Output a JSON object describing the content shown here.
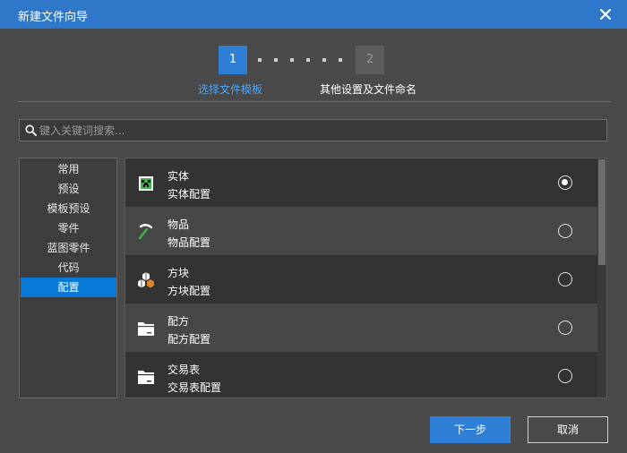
{
  "window": {
    "title": "新建文件向导"
  },
  "stepper": {
    "steps": [
      {
        "number": "1",
        "label": "选择文件模板",
        "active": true
      },
      {
        "number": "2",
        "label": "其他设置及文件命名",
        "active": false
      }
    ]
  },
  "search": {
    "placeholder": "键入关键词搜索...",
    "value": ""
  },
  "categories": {
    "items": [
      "常用",
      "预设",
      "模板预设",
      "零件",
      "蓝图零件",
      "代码",
      "配置"
    ],
    "selected_index": 6
  },
  "templates": [
    {
      "name": "实体",
      "description": "实体配置",
      "icon": "creeper-icon",
      "selected": true
    },
    {
      "name": "物品",
      "description": "物品配置",
      "icon": "pickaxe-icon",
      "selected": false
    },
    {
      "name": "方块",
      "description": "方块配置",
      "icon": "blocks-icon",
      "selected": false
    },
    {
      "name": "配方",
      "description": "配方配置",
      "icon": "folder-icon",
      "selected": false
    },
    {
      "name": "交易表",
      "description": "交易表配置",
      "icon": "folder-icon",
      "selected": false
    }
  ],
  "buttons": {
    "next_label": "下一步",
    "cancel_label": "取消"
  },
  "colors": {
    "accent": "#2f7fd6",
    "titlebar": "#2f77c9",
    "selected_category": "#0a78d7",
    "step_label_active": "#4fa3f0"
  }
}
